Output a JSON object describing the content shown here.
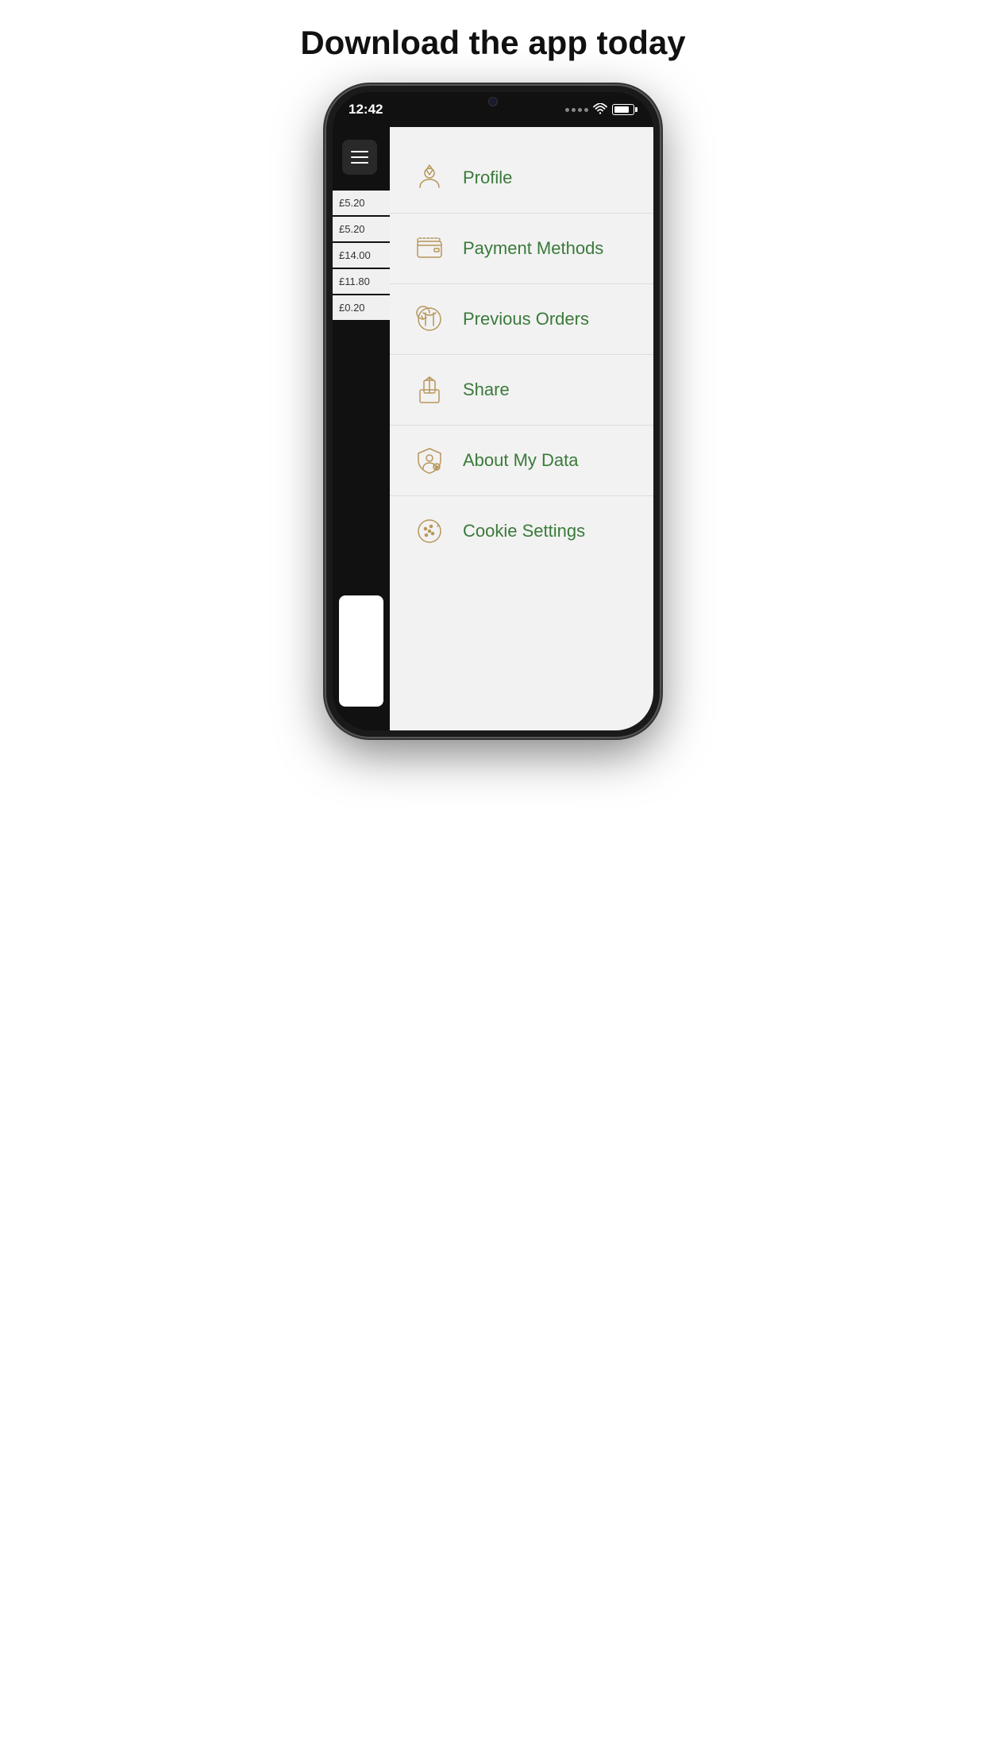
{
  "page": {
    "headline": "Download the app today"
  },
  "statusBar": {
    "time": "12:42"
  },
  "leftPanel": {
    "prices": [
      "£5.20",
      "£5.20",
      "£14.00",
      "£11.80",
      "£0.20"
    ]
  },
  "menu": {
    "items": [
      {
        "id": "profile",
        "label": "Profile",
        "icon": "profile"
      },
      {
        "id": "payment-methods",
        "label": "Payment Methods",
        "icon": "wallet"
      },
      {
        "id": "previous-orders",
        "label": "Previous Orders",
        "icon": "fork-knife"
      },
      {
        "id": "share",
        "label": "Share",
        "icon": "share"
      },
      {
        "id": "about-my-data",
        "label": "About My Data",
        "icon": "shield-user"
      },
      {
        "id": "cookie-settings",
        "label": "Cookie Settings",
        "icon": "cookie"
      }
    ]
  }
}
